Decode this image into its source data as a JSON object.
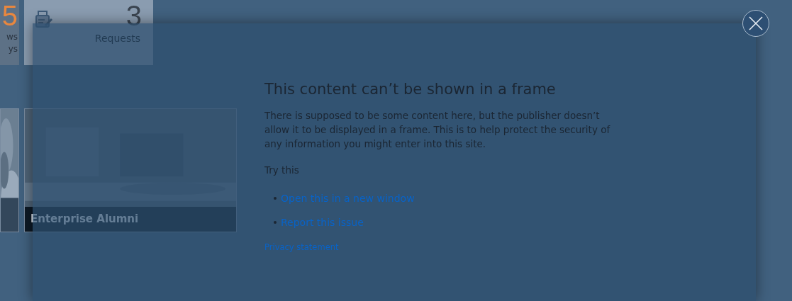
{
  "background": {
    "stat_tiles": [
      {
        "number": "5",
        "color": "#e8873f",
        "lines": [
          "ws",
          "ys"
        ]
      },
      {
        "number": "3",
        "color": "#3a4450",
        "lines": [
          "Requests"
        ]
      }
    ],
    "photo_tiles": [
      {
        "kind": "picture"
      },
      {
        "kind": "picture",
        "caption": "Enterprise Alumni"
      }
    ]
  },
  "dialog": {
    "heading": "This content can’t be shown in a frame",
    "message": "There is supposed to be some content here, but the publisher doesn’t allow it to be displayed in a frame. This is to help protect the security of any information you might enter into this site.",
    "prompt": "Try this",
    "links": [
      "Open this in a new window",
      "Report this issue"
    ],
    "privacy": "Privacy statement"
  }
}
